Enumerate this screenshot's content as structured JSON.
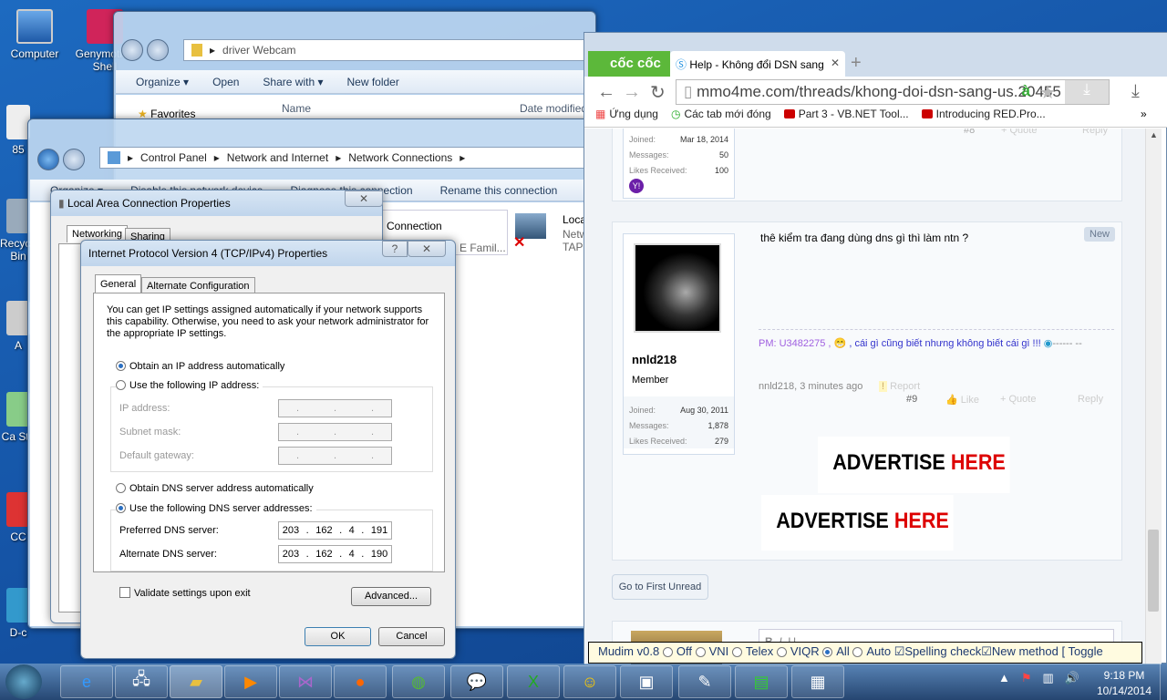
{
  "desktop": {
    "icons": [
      "Computer",
      "Genymotion Shell",
      "85",
      "Recycle Bin",
      "A",
      "Ca Stu",
      "CC",
      "D-c"
    ]
  },
  "explorer": {
    "path": "driver Webcam",
    "toolbar": [
      "Organize ▾",
      "Open",
      "Share with ▾",
      "New folder"
    ],
    "favorites": "Favorites",
    "columns": [
      "Name",
      "Date modified"
    ]
  },
  "netconn": {
    "breadcrumb": [
      "Control Panel",
      "Network and Internet",
      "Network Connections"
    ],
    "toolbar": [
      "Organize ▾",
      "Disable this network device",
      "Diagnose this connection",
      "Rename this connection",
      "»"
    ],
    "items": [
      {
        "name": "Connection",
        "sub": "E Famil..."
      },
      {
        "name": "Local",
        "sub1": "Netw",
        "sub2": "TAP"
      }
    ]
  },
  "lac": {
    "title": "Local Area Connection Properties",
    "tabs": [
      "Networking",
      "Sharing"
    ]
  },
  "ipv4": {
    "title": "Internet Protocol Version 4 (TCP/IPv4) Properties",
    "tabs": [
      "General",
      "Alternate Configuration"
    ],
    "intro": "You can get IP settings assigned automatically if your network supports this capability. Otherwise, you need to ask your network administrator for the appropriate IP settings.",
    "obtain_ip": "Obtain an IP address automatically",
    "use_ip": "Use the following IP address:",
    "ip_label": "IP address:",
    "subnet_label": "Subnet mask:",
    "gateway_label": "Default gateway:",
    "obtain_dns": "Obtain DNS server address automatically",
    "use_dns": "Use the following DNS server addresses:",
    "pref_label": "Preferred DNS server:",
    "alt_label": "Alternate DNS server:",
    "pref_dns": [
      "203",
      "162",
      "4",
      "191"
    ],
    "alt_dns": [
      "203",
      "162",
      "4",
      "190"
    ],
    "validate": "Validate settings upon exit",
    "advanced": "Advanced...",
    "ok": "OK",
    "cancel": "Cancel"
  },
  "browser": {
    "brand": "cốc cốc",
    "tab_title": "Help - Không đổi DSN sang",
    "url": "mmo4me.com/threads/khong-doi-dsn-sang-us.20455",
    "bookmarks": [
      "Ứng dụng",
      "Các tab mới đóng",
      "Part 3 - VB.NET Tool...",
      "Introducing RED.Pro..."
    ],
    "more": "»"
  },
  "post8": {
    "joined_label": "Joined:",
    "joined": "Mar 18, 2014",
    "messages_label": "Messages:",
    "messages": "50",
    "likes_label": "Likes Received:",
    "likes": "100",
    "num": "#8",
    "quote": "+ Quote",
    "reply": "Reply"
  },
  "post9": {
    "username": "nnld218",
    "role": "Member",
    "badge": "New",
    "message": "thê kiểm tra đang dùng dns gì thì làm ntn ?",
    "sig_pm": "PM: U3482275 ,",
    "sig_text": ", cái gì cũng biết nhưng không biết cái gì !!!",
    "sig_tail": "------ --",
    "meta": "nnld218, 3 minutes ago",
    "report": "Report",
    "num": "#9",
    "like": "Like",
    "quote": "+ Quote",
    "reply": "Reply",
    "joined_label": "Joined:",
    "joined": "Aug 30, 2011",
    "messages_label": "Messages:",
    "messages": "1,878",
    "likes_label": "Likes Received:",
    "likes": "279"
  },
  "ads": [
    {
      "a": "ADVERTISE",
      "b": "HERE"
    },
    {
      "a": "ADVERTISE",
      "b": "HERE"
    }
  ],
  "first_unread": "Go to First Unread",
  "mudim": {
    "name": "Mudim v0.8",
    "options": [
      "Off",
      "VNI",
      "Telex",
      "VIQR",
      "All",
      "Auto"
    ],
    "selected": "All",
    "spelling": "Spelling check",
    "new_method": "New method",
    "toggle": "[ Toggle"
  },
  "taskbar": {
    "time": "9:18 PM",
    "date": "10/14/2014"
  }
}
